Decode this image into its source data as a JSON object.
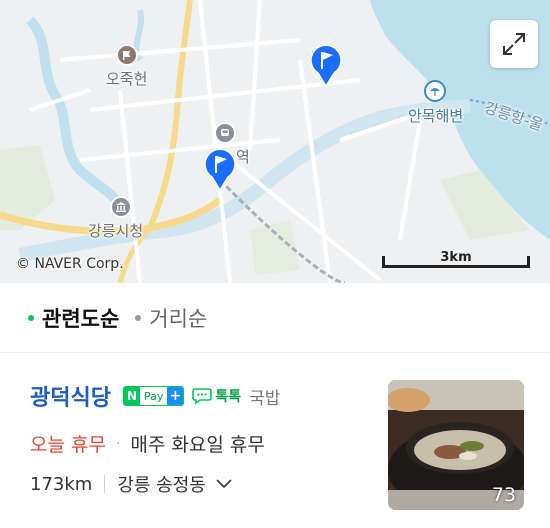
{
  "map": {
    "labels": {
      "ojukheon": "오죽헌",
      "station": "역",
      "city_hall": "강릉시청",
      "anmok_beach": "안목해변",
      "port_road": "강릉항-울"
    },
    "copyright": "© NAVER Corp.",
    "scale": "3km",
    "icons": {
      "expand": "expand-icon",
      "pin": "flag-pin-icon"
    }
  },
  "sort": {
    "options": [
      {
        "label": "관련도순",
        "active": true
      },
      {
        "label": "거리순",
        "active": false
      }
    ]
  },
  "result": {
    "name": "광덕식당",
    "npay": {
      "n": "N",
      "pay": "Pay",
      "plus": "+"
    },
    "talk_label": "톡톡",
    "category": "국밥",
    "status": "오늘 휴무",
    "separator": "·",
    "hours": "매주 화요일 휴무",
    "distance": "173km",
    "address": "강릉 송정동",
    "photo_count": "73"
  },
  "colors": {
    "accent_green": "#03c75a",
    "name_blue": "#1d5bc4",
    "closed_red": "#e3463a",
    "pin_blue": "#1a6dff"
  }
}
